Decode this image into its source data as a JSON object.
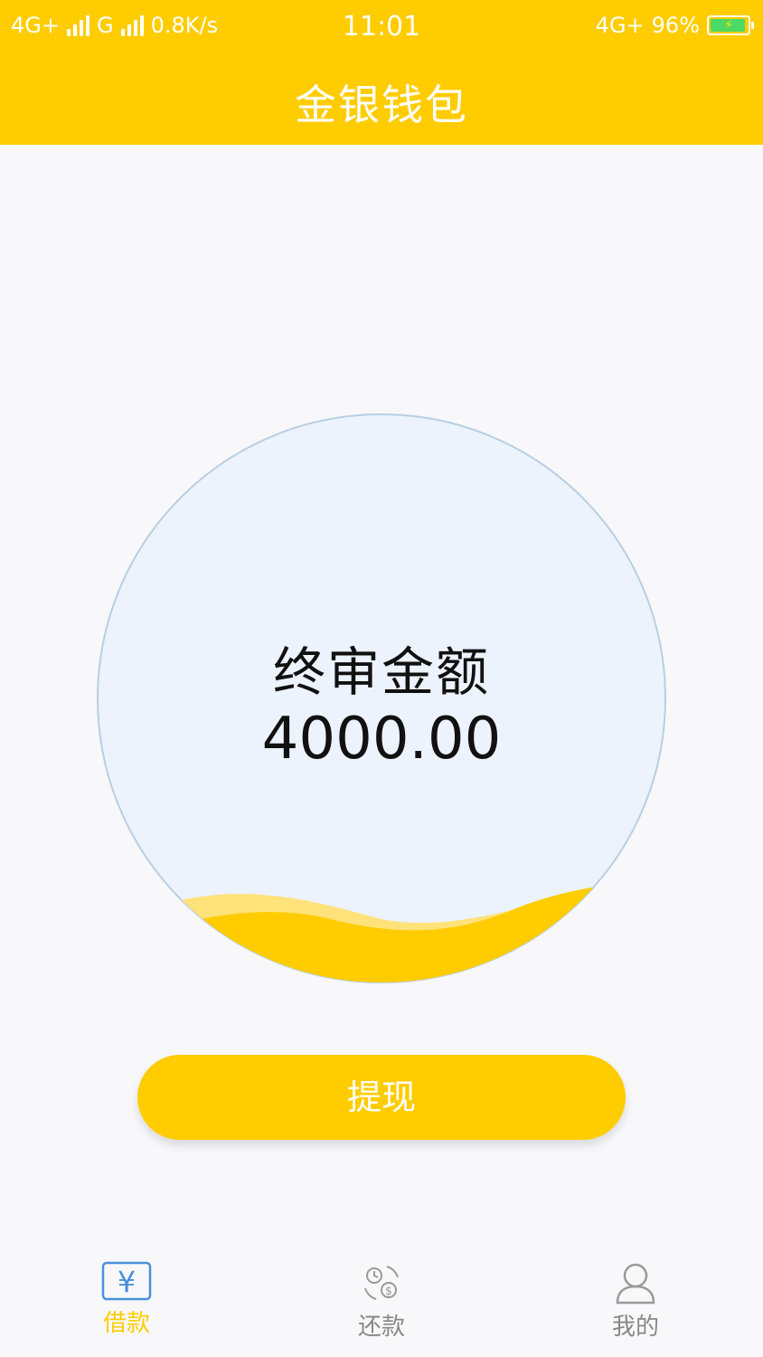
{
  "status_bar": {
    "network_1": "4G+",
    "network_2": "G",
    "speed": "0.8K/s",
    "time": "11:01",
    "network_right": "4G+",
    "battery_percent": "96%",
    "battery_level": 0.96
  },
  "header": {
    "title": "金银钱包"
  },
  "gauge": {
    "label": "终审金额",
    "amount": "4000.00"
  },
  "withdraw_button": {
    "label": "提现"
  },
  "tabbar": {
    "items": [
      {
        "label": "借款",
        "icon": "yen-icon",
        "active": true
      },
      {
        "label": "还款",
        "icon": "repay-icon",
        "active": false
      },
      {
        "label": "我的",
        "icon": "user-icon",
        "active": false
      }
    ]
  },
  "colors": {
    "accent": "#ffcc00",
    "active_tab": "#ffcc00",
    "inactive_tab": "#888888"
  }
}
